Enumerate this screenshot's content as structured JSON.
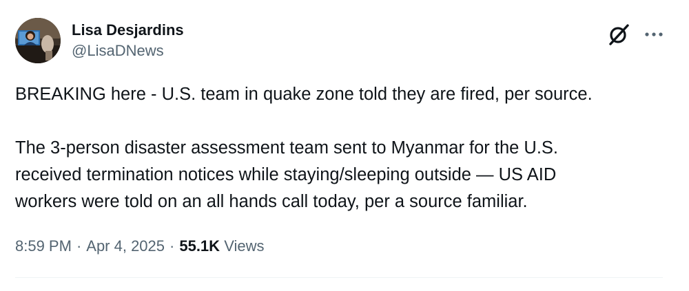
{
  "author": {
    "display_name": "Lisa Desjardins",
    "handle": "@LisaDNews"
  },
  "tweet": {
    "paragraphs": [
      "BREAKING here - U.S. team in quake zone told they are fired, per source.",
      "The 3-person disaster assessment team sent to Myanmar for the U.S.",
      "received termination notices while staying/sleeping outside  — US AID",
      "workers were told on an all hands call today, per a source familiar."
    ]
  },
  "meta": {
    "time": "8:59 PM",
    "separator": "·",
    "date": "Apr 4, 2025",
    "views_count": "55.1K",
    "views_label": "Views"
  },
  "icons": {
    "grok": "grok-icon",
    "more": "more-icon",
    "avatar": "avatar"
  },
  "colors": {
    "text_primary": "#0f1419",
    "text_secondary": "#536471",
    "divider": "#eff3f4",
    "background": "#ffffff"
  }
}
